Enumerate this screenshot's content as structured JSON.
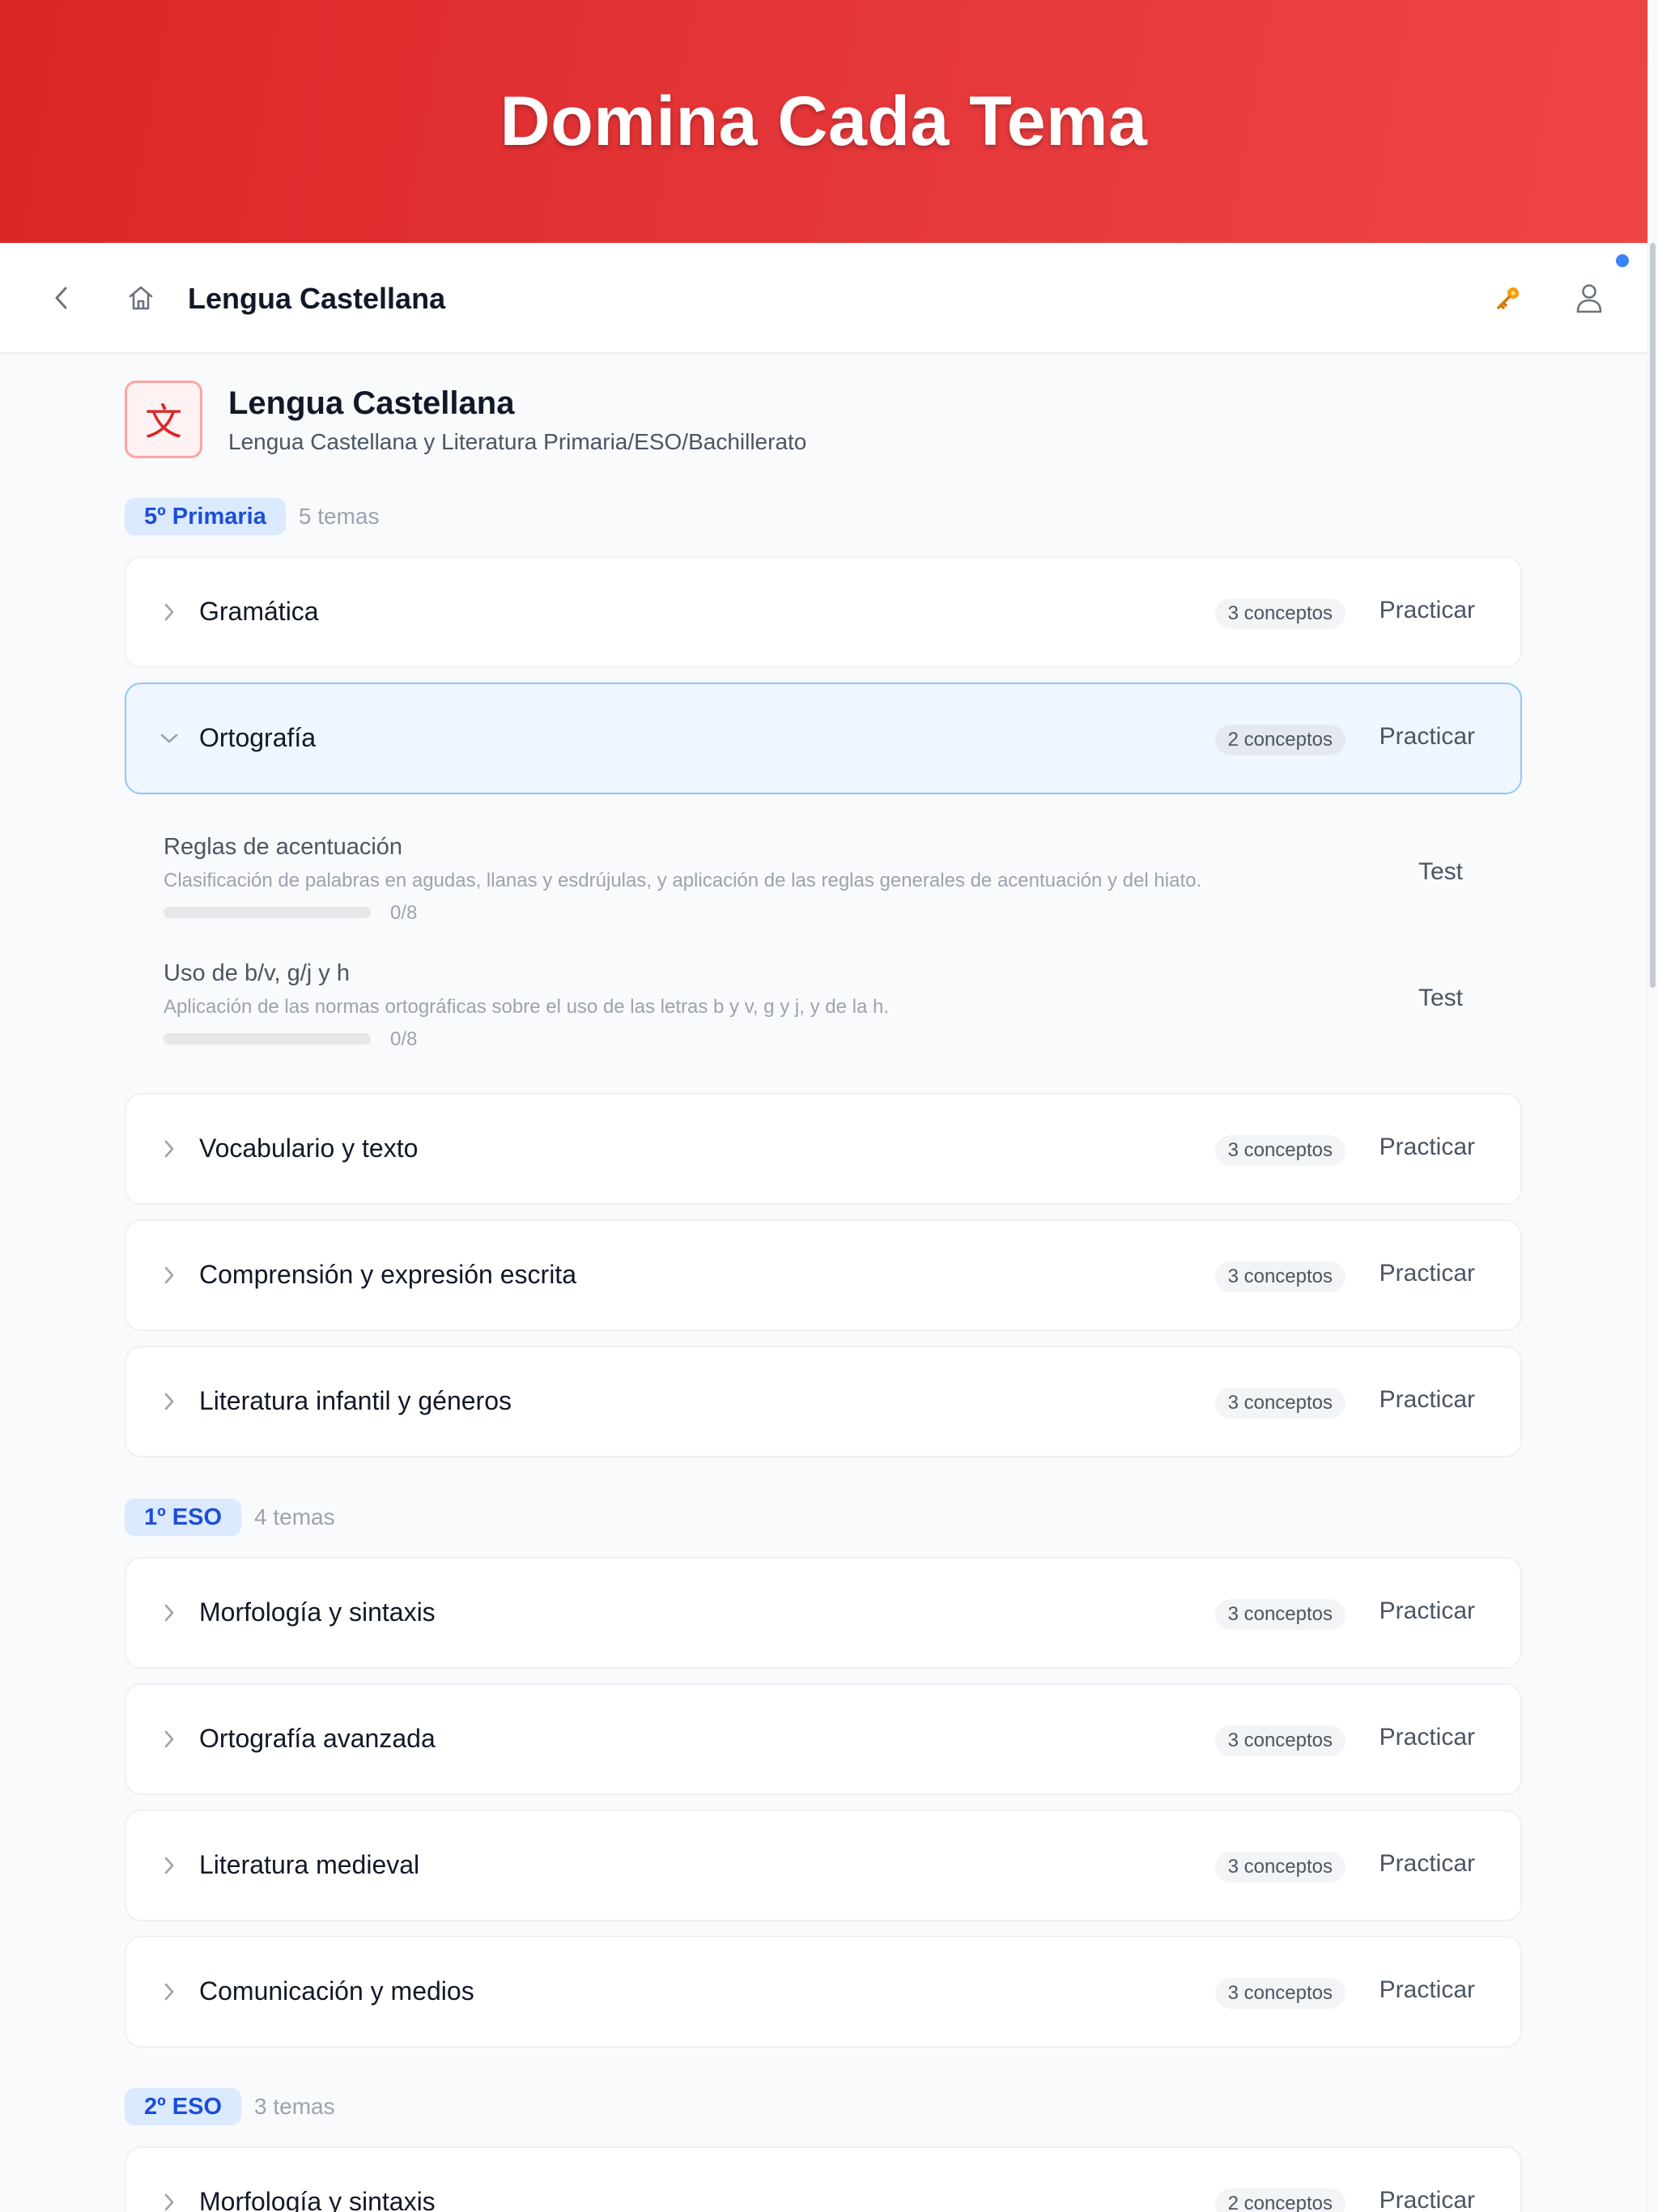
{
  "banner": {
    "title": "Domina Cada Tema"
  },
  "header": {
    "title": "Lengua Castellana"
  },
  "subject": {
    "logo_glyph": "文",
    "name": "Lengua Castellana",
    "description": "Lengua Castellana y Literatura Primaria/ESO/Bachillerato"
  },
  "levels": [
    {
      "label": "5º Primaria",
      "count": "5 temas"
    },
    {
      "label": "1º ESO",
      "count": "4 temas"
    },
    {
      "label": "2º ESO",
      "count": "3 temas"
    }
  ],
  "topics": [
    {
      "name": "Gramática",
      "concepts": "3 conceptos",
      "action": "Practicar",
      "expanded": false
    },
    {
      "name": "Ortografía",
      "concepts": "2 conceptos",
      "action": "Practicar",
      "expanded": true
    },
    {
      "name": "Vocabulario y texto",
      "concepts": "3 conceptos",
      "action": "Practicar",
      "expanded": false
    },
    {
      "name": "Comprensión y expresión escrita",
      "concepts": "3 conceptos",
      "action": "Practicar",
      "expanded": false
    },
    {
      "name": "Literatura infantil y géneros",
      "concepts": "3 conceptos",
      "action": "Practicar",
      "expanded": false
    },
    {
      "name": "Morfología y sintaxis",
      "concepts": "3 conceptos",
      "action": "Practicar",
      "expanded": false
    },
    {
      "name": "Ortografía avanzada",
      "concepts": "3 conceptos",
      "action": "Practicar",
      "expanded": false
    },
    {
      "name": "Literatura medieval",
      "concepts": "3 conceptos",
      "action": "Practicar",
      "expanded": false
    },
    {
      "name": "Comunicación y medios",
      "concepts": "3 conceptos",
      "action": "Practicar",
      "expanded": false
    },
    {
      "name": "Morfología y sintaxis",
      "concepts": "2 conceptos",
      "action": "Practicar",
      "expanded": false
    }
  ],
  "concepts": [
    {
      "name": "Reglas de acentuación",
      "description": "Clasificación de palabras en agudas, llanas y esdrújulas, y aplicación de las reglas generales de acentuación y del hiato.",
      "progress_label": "0/8",
      "progress_fraction": 0,
      "action": "Test"
    },
    {
      "name": "Uso de b/v, g/j y h",
      "description": "Aplicación de las normas ortográficas sobre el uso de las letras b y v, g y j, y de la h.",
      "progress_label": "0/8",
      "progress_fraction": 0,
      "action": "Test"
    }
  ],
  "colors": {
    "accent": "#dc2626",
    "badge_text": "#1d4ed8",
    "badge_bg": "#dbeafe",
    "notification": "#3b82f6"
  },
  "icons": {
    "back": "chevron-left-icon",
    "home": "home-icon",
    "key": "key-icon",
    "user": "user-icon"
  }
}
